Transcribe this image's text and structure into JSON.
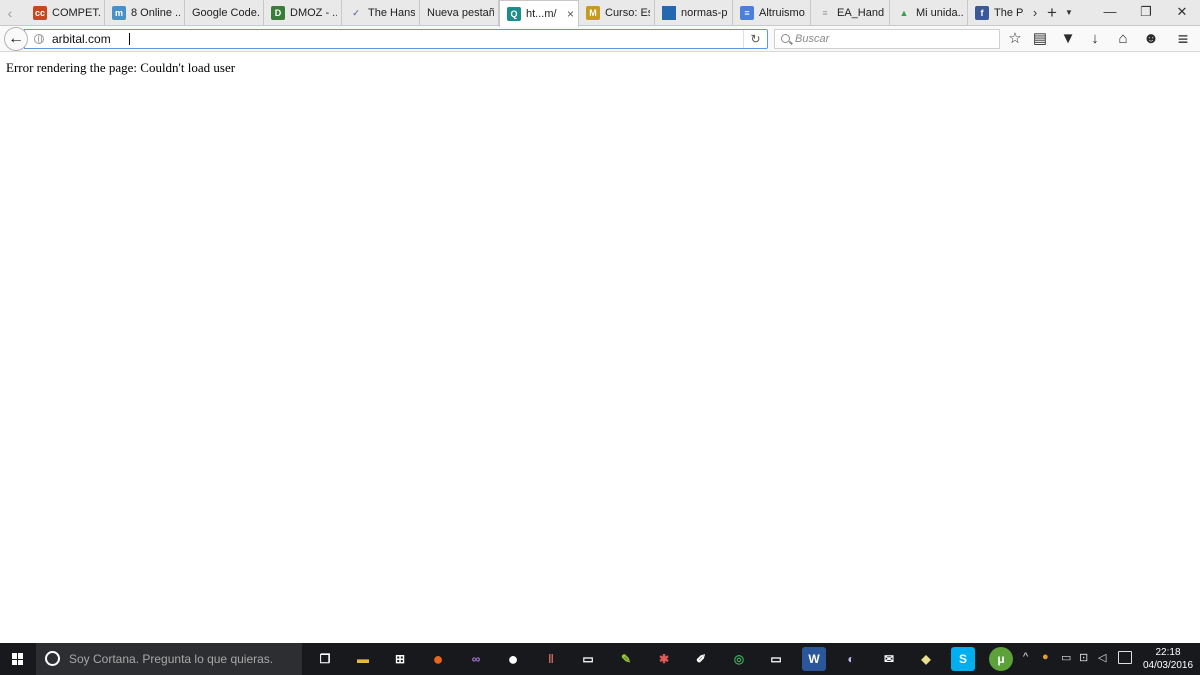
{
  "browser": {
    "tabs": [
      {
        "label": "COMPET...",
        "icon": "cc-logo-icon",
        "icon_text": "cc",
        "color": "#c9471f"
      },
      {
        "label": "8 Online ...",
        "icon": "m-logo-icon",
        "icon_text": "m",
        "color": "#4a90c8"
      },
      {
        "label": "Google Code...",
        "icon": "",
        "icon_text": "",
        "color": ""
      },
      {
        "label": "DMOZ - ...",
        "icon": "dmoz-logo-icon",
        "icon_text": "D",
        "color": "#3a7d3a"
      },
      {
        "label": "The Hans...",
        "icon": "hans-logo-icon",
        "icon_text": "✓",
        "color": "#6b7fa6"
      },
      {
        "label": "Nueva pestaña",
        "icon": "",
        "icon_text": "",
        "color": ""
      },
      {
        "label": "ht...m/",
        "icon": "page-icon",
        "icon_text": "Q",
        "color": "#1c8c8c",
        "active": true
      },
      {
        "label": "Curso: Est...",
        "icon": "curso-logo-icon",
        "icon_text": "M",
        "color": "#c99a22"
      },
      {
        "label": "normas-p...",
        "icon": "normas-logo-icon",
        "icon_text": "",
        "color": "#2468b0"
      },
      {
        "label": "Altruismo...",
        "icon": "docs-icon",
        "icon_text": "≡",
        "color": "#4a7fe0"
      },
      {
        "label": "EA_Hand...",
        "icon": "file-icon",
        "icon_text": "≡",
        "color": "#9a9a9a"
      },
      {
        "label": "Mi unida...",
        "icon": "drive-icon",
        "icon_text": "▲",
        "color": "#2f9e4d"
      },
      {
        "label": "The Pare",
        "icon": "facebook-icon",
        "icon_text": "f",
        "color": "#3b5998"
      }
    ],
    "close_tab_glyph": "×",
    "tabs_more_glyph": "›",
    "new_tab_glyph": "+",
    "tab_list_glyph": "▼",
    "window_buttons": {
      "minimize": "—",
      "restore": "❐",
      "close": "✕"
    },
    "nav": {
      "back_glyph": "←",
      "url": "arbital.com",
      "reload_glyph": "↻",
      "search_placeholder": "Buscar"
    },
    "toolbar_icons": [
      {
        "name": "bookmark-star-icon",
        "glyph": "☆"
      },
      {
        "name": "bookmarks-list-icon",
        "glyph": "▤"
      },
      {
        "name": "pocket-icon",
        "glyph": "▼"
      },
      {
        "name": "download-icon",
        "glyph": "↓"
      },
      {
        "name": "home-icon",
        "glyph": "⌂"
      },
      {
        "name": "chat-icon",
        "glyph": "☻"
      },
      {
        "name": "menu-icon",
        "glyph": "≡"
      }
    ]
  },
  "page": {
    "error_text": "Error rendering the page: Couldn't load user"
  },
  "taskbar": {
    "cortana_placeholder": "Soy Cortana. Pregunta lo que quieras.",
    "apps": [
      {
        "name": "task-view-icon",
        "glyph": "❐",
        "color": "transparent"
      },
      {
        "name": "file-explorer-icon",
        "glyph": "▬",
        "color": "#e7b83c"
      },
      {
        "name": "store-icon",
        "glyph": "⊞",
        "color": "transparent"
      },
      {
        "name": "firefox-icon",
        "glyph": "●",
        "color": "#e8661e"
      },
      {
        "name": "visual-studio-icon",
        "glyph": "∞",
        "color": "transparent"
      },
      {
        "name": "github-icon",
        "glyph": "●",
        "color": "transparent"
      },
      {
        "name": "library-icon",
        "glyph": "‖",
        "color": "transparent"
      },
      {
        "name": "console-icon",
        "glyph": "▭",
        "color": "transparent"
      },
      {
        "name": "editor-icon",
        "glyph": "✎",
        "color": "#7a9a2a"
      },
      {
        "name": "spider-icon",
        "glyph": "✱",
        "color": "transparent"
      },
      {
        "name": "notepad-icon",
        "glyph": "✐",
        "color": "transparent"
      },
      {
        "name": "green-app-icon",
        "glyph": "◎",
        "color": "transparent"
      },
      {
        "name": "terminal-icon",
        "glyph": "▭",
        "color": "transparent"
      },
      {
        "name": "word-icon",
        "glyph": "W",
        "color": "#2b579a"
      },
      {
        "name": "eclipse-icon",
        "glyph": "◐",
        "color": "transparent"
      },
      {
        "name": "mail-icon",
        "glyph": "✉",
        "color": "transparent"
      },
      {
        "name": "folder-app-icon",
        "glyph": "◆",
        "color": "transparent"
      },
      {
        "name": "skype-icon",
        "glyph": "S",
        "color": "#00aff0"
      },
      {
        "name": "utorrent-icon",
        "glyph": "μ",
        "color": "#5ca13a"
      }
    ],
    "tray_icons": [
      {
        "name": "show-hidden-icons-icon",
        "glyph": "^"
      },
      {
        "name": "security-icon",
        "glyph": "●"
      },
      {
        "name": "battery-icon",
        "glyph": "▭"
      },
      {
        "name": "network-icon",
        "glyph": "⊡"
      },
      {
        "name": "volume-icon",
        "glyph": "◁"
      }
    ],
    "time": "22:18",
    "date": "04/03/2016"
  }
}
